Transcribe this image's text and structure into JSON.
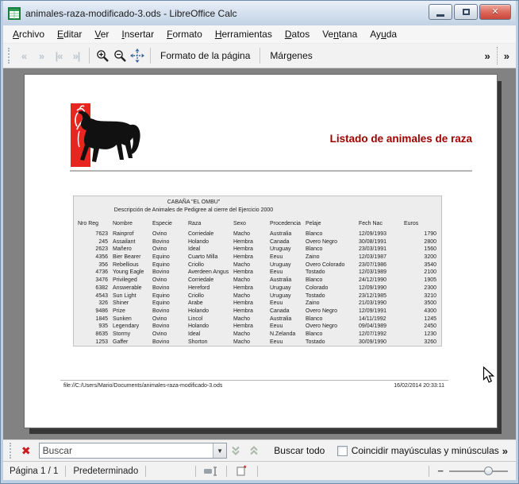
{
  "window": {
    "title": "animales-raza-modificado-3.ods - LibreOffice Calc"
  },
  "menubar": {
    "items": [
      {
        "label": "Archivo",
        "mnemonic": 0
      },
      {
        "label": "Editar",
        "mnemonic": 0
      },
      {
        "label": "Ver",
        "mnemonic": 0
      },
      {
        "label": "Insertar",
        "mnemonic": 0
      },
      {
        "label": "Formato",
        "mnemonic": 0
      },
      {
        "label": "Herramientas",
        "mnemonic": 0
      },
      {
        "label": "Datos",
        "mnemonic": 0
      },
      {
        "label": "Ventana",
        "mnemonic": 2
      },
      {
        "label": "Ayuda",
        "mnemonic": 2
      }
    ]
  },
  "toolbar": {
    "format_page_label": "Formato de la página",
    "margins_label": "Márgenes"
  },
  "icons": {
    "prev_page": "«",
    "next_page": "»",
    "first_page": "|«",
    "last_page": "»|",
    "overflow": "»",
    "find_close": "✖",
    "dropdown_arrow": "▼",
    "slider_minus": "−",
    "close_window": "✕"
  },
  "preview": {
    "title": "Listado de animales de raza",
    "table": {
      "caption1": "CABAÑA  \"EL OMBU\"",
      "caption2": "Descripción de Animales de Pedigree al cierre del Ejercicio 2000",
      "columns": [
        "Nro Reg",
        "Nombre",
        "Especie",
        "Raza",
        "Sexo",
        "Procedencia",
        "Pelaje",
        "Fech Nac",
        "Euros"
      ],
      "rows": [
        [
          "7623",
          "Rainprof",
          "Ovino",
          "Corriedale",
          "Macho",
          "Australia",
          "Blanco",
          "12/09/1993",
          "1790"
        ],
        [
          "245",
          "Assailant",
          "Bovino",
          "Holando",
          "Hembra",
          "Canada",
          "Overo Negro",
          "30/08/1991",
          "2800"
        ],
        [
          "2623",
          "Mañero",
          "Ovino",
          "Ideal",
          "Hembra",
          "Uruguay",
          "Blanco",
          "23/03/1991",
          "1560"
        ],
        [
          "4356",
          "Bier Bearer",
          "Equino",
          "Cuarto Milla",
          "Hembra",
          "Eeuu",
          "Zaino",
          "12/03/1987",
          "3200"
        ],
        [
          "356",
          "Rebellious",
          "Equino",
          "Criollo",
          "Macho",
          "Uruguay",
          "Overo Colorado",
          "23/07/1986",
          "3540"
        ],
        [
          "4736",
          "Young Eagle",
          "Bovino",
          "Averdeen Angus",
          "Hembra",
          "Eeuu",
          "Tostado",
          "12/03/1989",
          "2100"
        ],
        [
          "3476",
          "Privileged",
          "Ovino",
          "Corriedale",
          "Macho",
          "Australia",
          "Blanco",
          "24/12/1990",
          "1905"
        ],
        [
          "6382",
          "Answerable",
          "Bovino",
          "Hereford",
          "Hembra",
          "Uruguay",
          "Colorado",
          "12/09/1990",
          "2300"
        ],
        [
          "4543",
          "Sun Light",
          "Equino",
          "Criollo",
          "Macho",
          "Uruguay",
          "Tostado",
          "23/12/1985",
          "3210"
        ],
        [
          "326",
          "Shiner",
          "Equino",
          "Arabe",
          "Hembra",
          "Eeuu",
          "Zaino",
          "21/03/1990",
          "3500"
        ],
        [
          "9486",
          "Prize",
          "Bovino",
          "Holando",
          "Hembra",
          "Canada",
          "Overo Negro",
          "12/09/1991",
          "4300"
        ],
        [
          "1845",
          "Sunken",
          "Ovino",
          "Lincol",
          "Macho",
          "Australia",
          "Blanco",
          "14/11/1992",
          "1245"
        ],
        [
          "935",
          "Legendary",
          "Bovino",
          "Holando",
          "Hembra",
          "Eeuu",
          "Overo Negro",
          "09/04/1989",
          "2450"
        ],
        [
          "8635",
          "Stormy",
          "Ovino",
          "Ideal",
          "Macho",
          "N.Zelanda",
          "Blanco",
          "12/07/1992",
          "1230"
        ],
        [
          "1253",
          "Gaffer",
          "Bovino",
          "Shorton",
          "Macho",
          "Eeuu",
          "Tostado",
          "30/09/1990",
          "3260"
        ]
      ]
    },
    "footer": {
      "path": "file://C:/Users/Mario/Documents/animales-raza-modificado-3.ods",
      "datetime": "16/02/2014 20:33:11"
    }
  },
  "findbar": {
    "placeholder": "Buscar",
    "find_all_label": "Buscar todo",
    "match_case_label": "Coincidir mayúsculas y minúsculas"
  },
  "statusbar": {
    "page_label": "Página 1 / 1",
    "style_label": "Predeterminado"
  },
  "colors": {
    "title_red": "#a00000",
    "logo_red": "#e8251f",
    "workspace_gray": "#828282",
    "close_button_red": "#c8473a"
  }
}
